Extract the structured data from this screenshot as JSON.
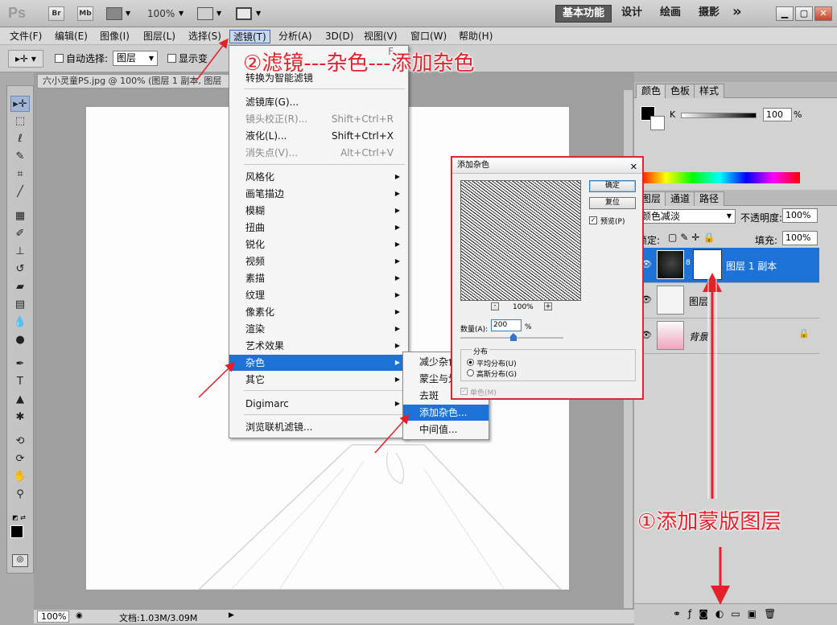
{
  "titlebar": {
    "logo": "Ps",
    "bridge": "Br",
    "minibridge": "Mb",
    "zoom": "100%",
    "workspaces": [
      "基本功能",
      "设计",
      "绘画",
      "摄影"
    ],
    "more": "»"
  },
  "menubar": [
    "文件(F)",
    "编辑(E)",
    "图像(I)",
    "图层(L)",
    "选择(S)",
    "滤镜(T)",
    "分析(A)",
    "3D(D)",
    "视图(V)",
    "窗口(W)",
    "帮助(H)"
  ],
  "options": {
    "auto_select_label": "自动选择:",
    "auto_select_value": "图层",
    "show_transform_label": "显示变"
  },
  "document": {
    "tab_title": "六小灵童PS.jpg @ 100% (图层 1 副本, 图层",
    "status_zoom": "100%",
    "status_doc": "文档:1.03M/3.09M"
  },
  "filter_menu": {
    "items": [
      {
        "label": "转换为智能滤镜",
        "shortcut": "",
        "disabled": false
      },
      {
        "label": "滤镜库(G)...",
        "shortcut": "",
        "disabled": false
      },
      {
        "label": "镜头校正(R)...",
        "shortcut": "Shift+Ctrl+R",
        "disabled": true
      },
      {
        "label": "液化(L)...",
        "shortcut": "Shift+Ctrl+X",
        "disabled": false
      },
      {
        "label": "消失点(V)...",
        "shortcut": "Alt+Ctrl+V",
        "disabled": true
      },
      {
        "label": "风格化"
      },
      {
        "label": "画笔描边"
      },
      {
        "label": "模糊"
      },
      {
        "label": "扭曲"
      },
      {
        "label": "锐化"
      },
      {
        "label": "视频"
      },
      {
        "label": "素描"
      },
      {
        "label": "纹理"
      },
      {
        "label": "像素化"
      },
      {
        "label": "渲染"
      },
      {
        "label": "艺术效果"
      },
      {
        "label": "杂色"
      },
      {
        "label": "其它"
      },
      {
        "label": "Digimarc"
      },
      {
        "label": "浏览联机滤镜..."
      }
    ],
    "partial_top": "F"
  },
  "noise_submenu": [
    "减少杂色",
    "蒙尘与划",
    "去斑",
    "添加杂色...",
    "中间值..."
  ],
  "dialog": {
    "title": "添加杂色",
    "ok": "确定",
    "reset": "复位",
    "preview_label": "预览(P)",
    "zoom": "100%",
    "minus": "-",
    "plus": "+",
    "amount_label": "数量(A):",
    "amount_value": "200",
    "amount_unit": "%",
    "distribution_label": "分布",
    "uniform": "平均分布(U)",
    "gaussian": "高斯分布(G)",
    "mono": "单色(M)"
  },
  "panels": {
    "color_tabs": [
      "颜色",
      "色板",
      "样式"
    ],
    "k_label": "K",
    "k_value": "100",
    "k_unit": "%",
    "layer_tabs": [
      "图层",
      "通道",
      "路径"
    ],
    "blend_mode": "颜色减淡",
    "opacity_label": "不透明度:",
    "opacity_value": "100%",
    "lock_label": "锁定:",
    "fill_label": "填充:",
    "fill_value": "100%",
    "layers": [
      "图层 1 副本",
      "图层",
      "背景"
    ]
  },
  "annotations": {
    "step2": "②滤镜---杂色---添加杂色",
    "step1": "①添加蒙版图层"
  },
  "colors": {
    "accent": "#1d72d8",
    "annotation": "#e4202a"
  }
}
